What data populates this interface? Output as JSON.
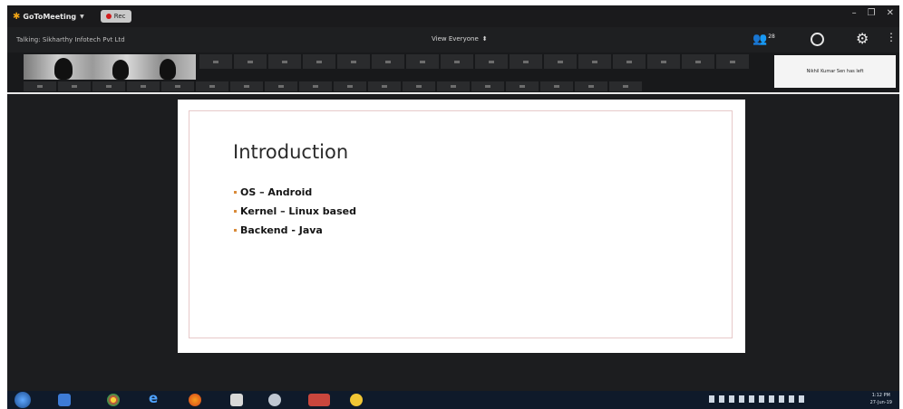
{
  "window": {
    "app_name": "GoToMeeting",
    "rec_label": "Rec"
  },
  "toolbar": {
    "talking_text": "Talking: Sikharthy Infotech Pvt Ltd",
    "view_selector": "View Everyone",
    "participant_count": "28"
  },
  "notification": {
    "text": "Nikhil Kumar Sen has left"
  },
  "slide": {
    "title": "Introduction",
    "bullets": [
      "OS – Android",
      "Kernel – Linux based",
      "Backend - Java"
    ]
  },
  "taskbar": {
    "time": "1:12 PM",
    "date": "27-Jun-19"
  },
  "icons": {
    "app_logo": "star-icon",
    "people": "people-icon",
    "chat": "chat-icon",
    "settings": "gear-icon",
    "more": "more-icon"
  },
  "colors": {
    "accent_logo": "#f2a516",
    "record": "#d11c1c",
    "bullet": "#d98b3a",
    "stage_bg": "#1c1d1f"
  }
}
